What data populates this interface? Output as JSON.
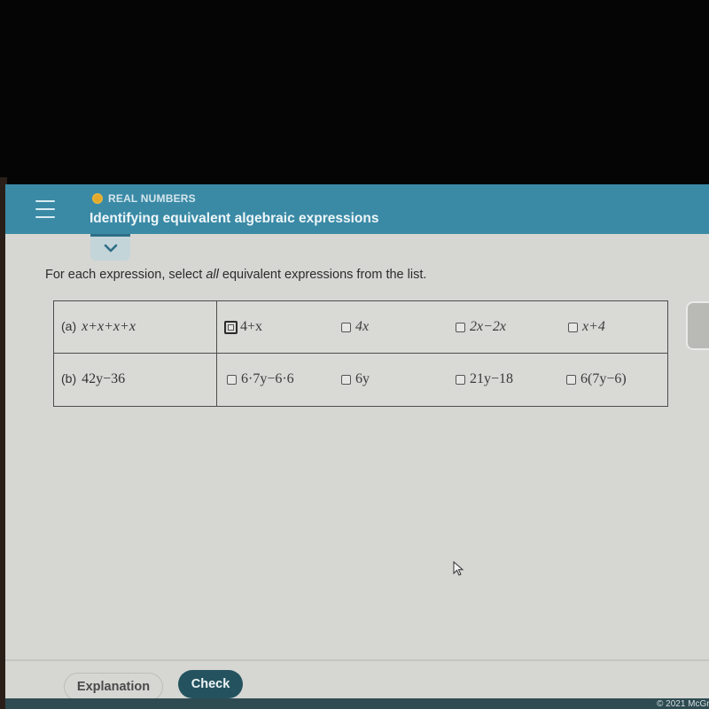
{
  "header": {
    "menu_icon": "hamburger-icon",
    "topic_status_icon": "status-dot-icon",
    "topic_status_color": "#e3a82a",
    "topic": "REAL NUMBERS",
    "title": "Identifying equivalent algebraic expressions",
    "accent_color": "#3a8aa6"
  },
  "collapse_toggle": {
    "icon": "chevron-down-icon"
  },
  "instructions": {
    "before": "For each expression, select ",
    "emphasis": "all",
    "after": " equivalent expressions from the list."
  },
  "questions": [
    {
      "label": "(a)",
      "expression": "x+x+x+x",
      "options": [
        {
          "text": "4+x",
          "checked": false,
          "focused": true
        },
        {
          "text": "4x",
          "checked": false,
          "focused": false
        },
        {
          "text": "2x−2x",
          "checked": false,
          "focused": false
        },
        {
          "text": "x+4",
          "checked": false,
          "focused": false
        }
      ]
    },
    {
      "label": "(b)",
      "expression": "42y−36",
      "options": [
        {
          "text": "6·7y−6·6",
          "checked": false,
          "focused": false
        },
        {
          "text": "6y",
          "checked": false,
          "focused": false
        },
        {
          "text": "21y−18",
          "checked": false,
          "focused": false
        },
        {
          "text": "6(7y−6)",
          "checked": false,
          "focused": false
        }
      ]
    }
  ],
  "footer": {
    "explanation_label": "Explanation",
    "check_label": "Check",
    "copyright": "© 2021 McGr"
  },
  "cursor_icon": "mouse-pointer-icon"
}
